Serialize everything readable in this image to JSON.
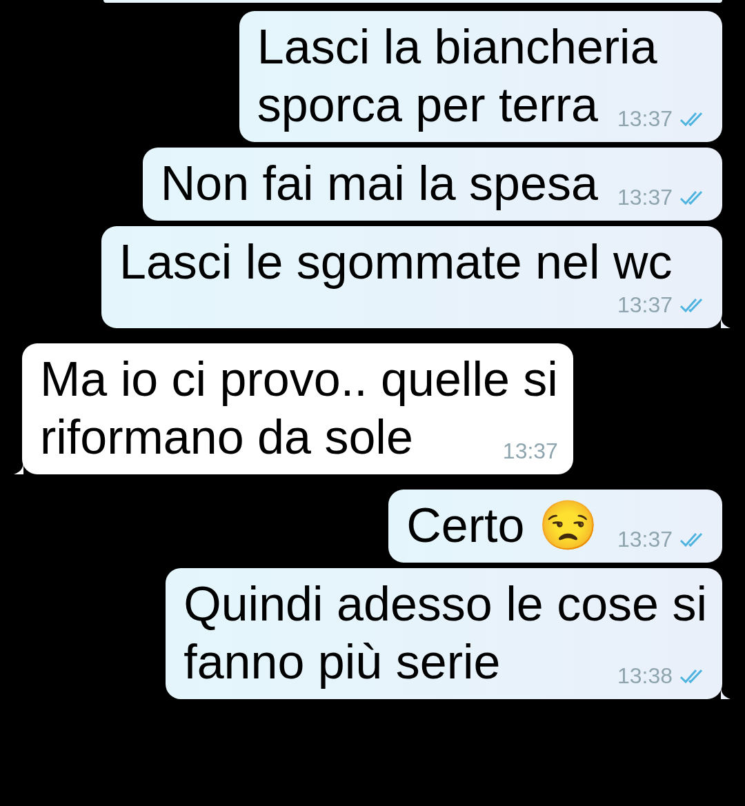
{
  "messages": [
    {
      "kind": "outgoing",
      "lines": [
        "Lasci la biancheria",
        "sporca per terra"
      ],
      "time": "13:37",
      "read": true,
      "tail": false
    },
    {
      "kind": "outgoing",
      "lines": [
        "Non fai mai la spesa"
      ],
      "time": "13:37",
      "read": true,
      "tail": false
    },
    {
      "kind": "outgoing",
      "lines": [
        "Lasci le sgommate nel wc"
      ],
      "time": "13:37",
      "read": true,
      "tail": true
    },
    {
      "kind": "incoming",
      "lines": [
        "Ma io ci provo.. quelle si",
        "riformano da sole"
      ],
      "time": "13:37",
      "tail": true
    },
    {
      "kind": "outgoing",
      "lines": [
        "Certo 😒"
      ],
      "time": "13:37",
      "read": true,
      "tail": false
    },
    {
      "kind": "outgoing",
      "lines": [
        "Quindi adesso le cose si",
        "fanno più serie"
      ],
      "time": "13:38",
      "read": true,
      "tail": true
    }
  ]
}
